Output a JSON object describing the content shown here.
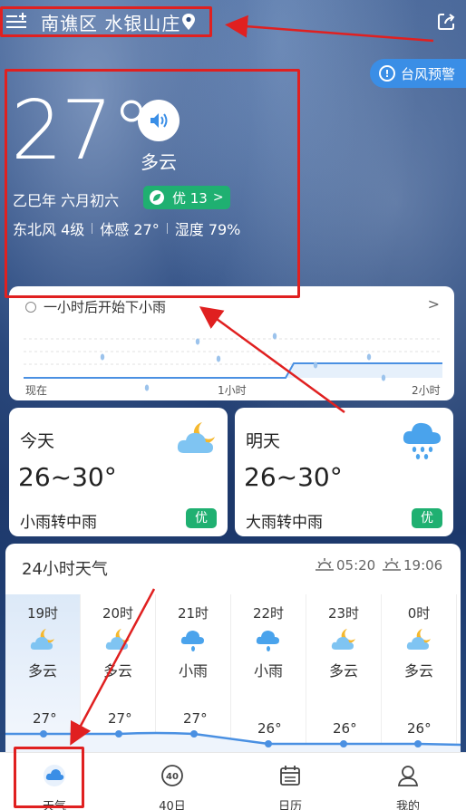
{
  "header": {
    "location": "南谯区 水银山庄"
  },
  "alert": {
    "label": "台风预警"
  },
  "current": {
    "temperature": "27°",
    "condition": "多云",
    "lunar_date": "乙巳年 六月初六",
    "aqi": "优 13",
    "wind": "东北风 4级",
    "feels_like": "体感 27°",
    "humidity": "湿度 79%"
  },
  "minutely": {
    "title": "一小时后开始下小雨",
    "axis": [
      "现在",
      "1小时",
      "2小时"
    ]
  },
  "days": [
    {
      "name": "今天",
      "range": "26~30°",
      "condition": "小雨转中雨",
      "quality": "优"
    },
    {
      "name": "明天",
      "range": "26~30°",
      "condition": "大雨转中雨",
      "quality": "优"
    }
  ],
  "hourly": {
    "title": "24小时天气",
    "sunrise": "05:20",
    "sunset": "19:06",
    "hours": [
      {
        "time": "19时",
        "cond": "多云",
        "temp": "27°",
        "icon": "partly-cloudy-night"
      },
      {
        "time": "20时",
        "cond": "多云",
        "temp": "27°",
        "icon": "partly-cloudy-night"
      },
      {
        "time": "21时",
        "cond": "小雨",
        "temp": "27°",
        "icon": "light-rain"
      },
      {
        "time": "22时",
        "cond": "小雨",
        "temp": "26°",
        "icon": "light-rain"
      },
      {
        "time": "23时",
        "cond": "多云",
        "temp": "26°",
        "icon": "partly-cloudy-night"
      },
      {
        "time": "0时",
        "cond": "多云",
        "temp": "26°",
        "icon": "partly-cloudy-night"
      }
    ]
  },
  "tabs": [
    {
      "label": "天气",
      "icon": "weather-cloud-icon"
    },
    {
      "label": "40日",
      "icon": "40-day-icon"
    },
    {
      "label": "日历",
      "icon": "calendar-icon"
    },
    {
      "label": "我的",
      "icon": "profile-icon"
    }
  ],
  "colors": {
    "accent": "#3a8ee6",
    "good": "#1fb071",
    "annotation": "#e02020"
  }
}
